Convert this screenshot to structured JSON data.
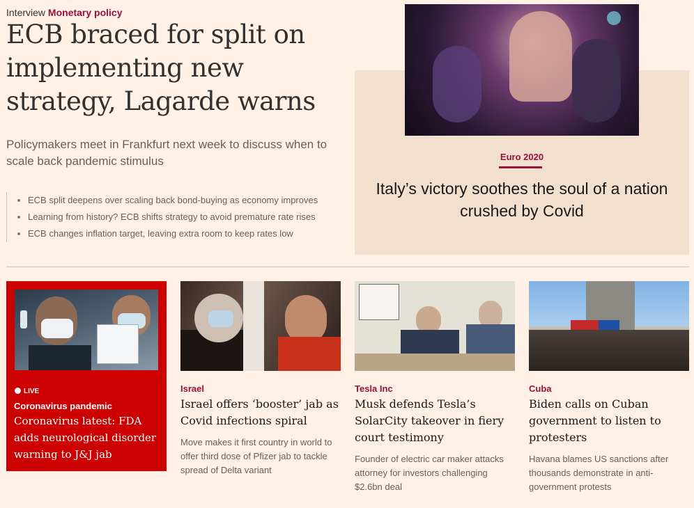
{
  "lead": {
    "genre": "Interview",
    "topic": "Monetary policy",
    "headline": "ECB braced for split on implementing new strategy, Lagarde warns",
    "standfirst": "Policymakers meet in Frankfurt next week to discuss when to scale back pandemic stimulus",
    "related": [
      "ECB split deepens over scaling back bond-buying as economy improves",
      "Learning from history? ECB shifts strategy to avoid premature rate rises",
      "ECB changes inflation target, leaving extra room to keep rates low"
    ]
  },
  "feature": {
    "tag": "Euro 2020",
    "headline": "Italy’s victory soothes the soul of a nation crushed by Covid",
    "accent": "#990f3d",
    "box_color": "#f2dfce"
  },
  "cards": {
    "live": {
      "badge": "LIVE",
      "tag": "Coronavirus pandemic",
      "headline": "Coronavirus latest: FDA adds neurological disorder warning to J&J jab",
      "color": "#cc0000"
    },
    "israel": {
      "tag": "Israel",
      "headline": "Israel offers ‘booster’ jab as Covid infections spiral",
      "summary": "Move makes it first country in world to offer third dose of Pfizer jab to tackle spread of Delta variant"
    },
    "tesla": {
      "tag": "Tesla Inc",
      "headline": "Musk defends Tesla’s SolarCity takeover in fiery court testimony",
      "summary": "Founder of electric car maker attacks attorney for investors challenging $2.6bn deal"
    },
    "cuba": {
      "tag": "Cuba",
      "headline": "Biden calls on Cuban government to listen to protesters",
      "summary": "Havana blames US sanctions after thousands demonstrate in anti-government protests"
    }
  },
  "colors": {
    "background": "#fff1e5",
    "claret": "#990f3d",
    "text": "#33302e",
    "muted": "#66605c"
  }
}
